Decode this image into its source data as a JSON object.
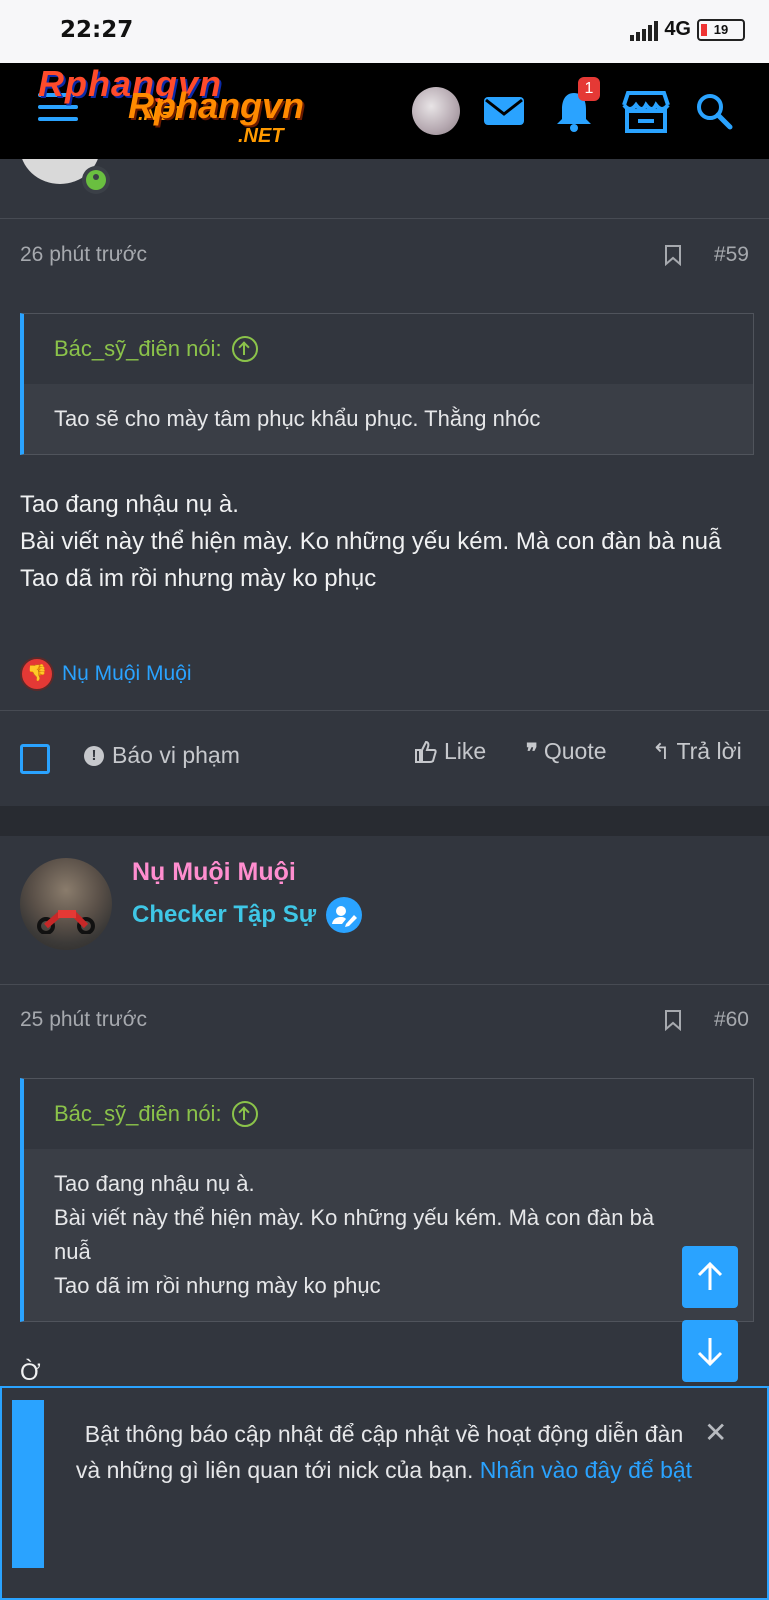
{
  "status_bar": {
    "time": "22:27",
    "network": "4G",
    "battery": "19"
  },
  "header": {
    "logo_top": "Rphangvn",
    "logo_net": ".NET",
    "logo_overlay": "Rphangvn",
    "logo_net_overlay": ".NET",
    "notification_count": "1",
    "accent": "#2aa3ff"
  },
  "posts": [
    {
      "time": "26 phút trước",
      "number": "#59",
      "quote_author": "Bác_sỹ_điên nói:",
      "quote_text": "Tao sẽ cho mày tâm phục khẩu phục. Thằng nhóc",
      "body_lines": [
        "Tao đang nhậu nụ à.",
        "Bài viết này thể hiện mày. Ko những yếu kém. Mà con đàn bà nuẫ",
        "Tao dã im rồi nhưng mày ko phục"
      ],
      "reaction_user": "Nụ Muội Muội",
      "actions": {
        "report": "Báo vi phạm",
        "like": "Like",
        "quote": "Quote",
        "reply": "Trả lời"
      }
    },
    {
      "username": "Nụ Muội Muội",
      "user_title": "Checker Tập Sự",
      "time": "25 phút trước",
      "number": "#60",
      "quote_author": "Bác_sỹ_điên nói:",
      "quote_lines": [
        "Tao đang nhậu nụ à.",
        "Bài viết này thể hiện mày. Ko những yếu kém. Mà con đàn bà nuẫ",
        "Tao dã im rồi nhưng mày ko phục"
      ],
      "body": "Ờ"
    }
  ],
  "notice": {
    "text": "Bật thông báo cập nhật để cập nhật về hoạt động diễn đàn và những gì liên quan tới nick của bạn.",
    "link": "Nhấn vào đây để bật"
  }
}
